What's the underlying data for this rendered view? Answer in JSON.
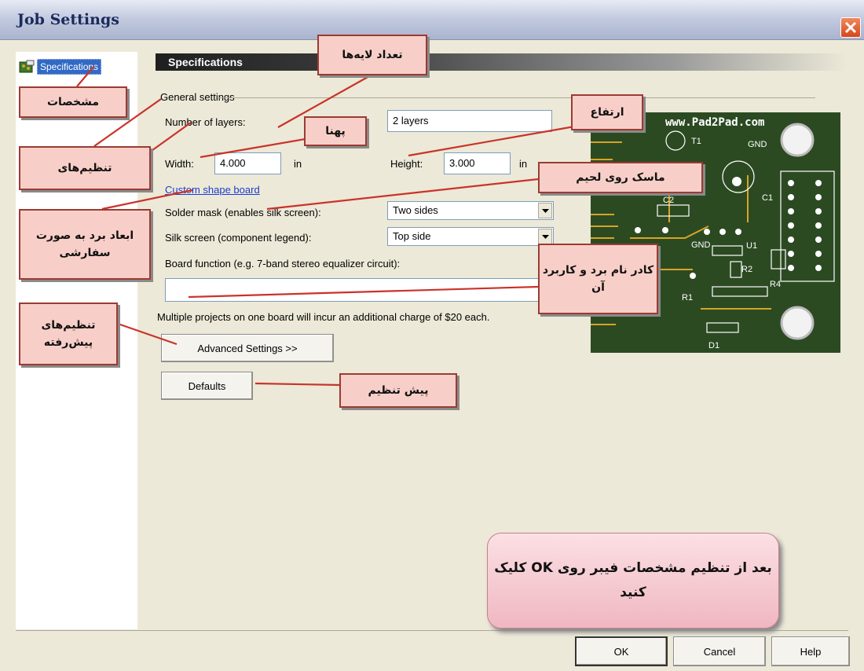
{
  "window": {
    "title": "Job Settings"
  },
  "nav": {
    "specifications": "Specifications"
  },
  "panel": {
    "header": "Specifications",
    "group_label": "General settings"
  },
  "form": {
    "layers_label": "Number of layers:",
    "layers_value": "2 layers",
    "width_label": "Width:",
    "width_value": "4.000",
    "width_unit": "in",
    "height_label": "Height:",
    "height_value": "3.000",
    "height_unit": "in",
    "custom_shape_link": "Custom shape board",
    "solder_label": "Solder mask (enables silk screen):",
    "solder_value": "Two sides",
    "silk_label": "Silk screen (component legend):",
    "silk_value": "Top side",
    "function_label": "Board function (e.g. 7-band stereo equalizer circuit):",
    "function_value": "",
    "multi_note": "Multiple projects on one board will incur an additional charge of $20 each.",
    "advanced_button": "Advanced Settings >>",
    "defaults_button": "Defaults"
  },
  "board_preview": {
    "site": "www.Pad2Pad.com",
    "labels": [
      "T1",
      "GND",
      "C2",
      "C1",
      "GND",
      "U1",
      "R2",
      "R4",
      "R1",
      "D1"
    ],
    "colors": {
      "board": "#2c4a22",
      "silk": "#ffffff",
      "pad": "#d8a425"
    }
  },
  "dialog_buttons": {
    "ok": "OK",
    "cancel": "Cancel",
    "help": "Help"
  },
  "annotations": {
    "specs": "مشخصات",
    "layers": "تعداد لایه‌ها",
    "width": "پهنا",
    "height": "ارتفاع",
    "settings": "تنظیم‌های",
    "solder": "ماسک روی لحیم",
    "custom_shape": "ابعاد برد به صورت سفارشی",
    "board_function": "کادر نام برد و کاربرد آن",
    "advanced": "تنظیم‌های پیش‌رفته",
    "defaults": "پیش تنظیم",
    "final_note": "بعد از تنظیم مشخصات فیبر روی OK کلیک کنید"
  }
}
